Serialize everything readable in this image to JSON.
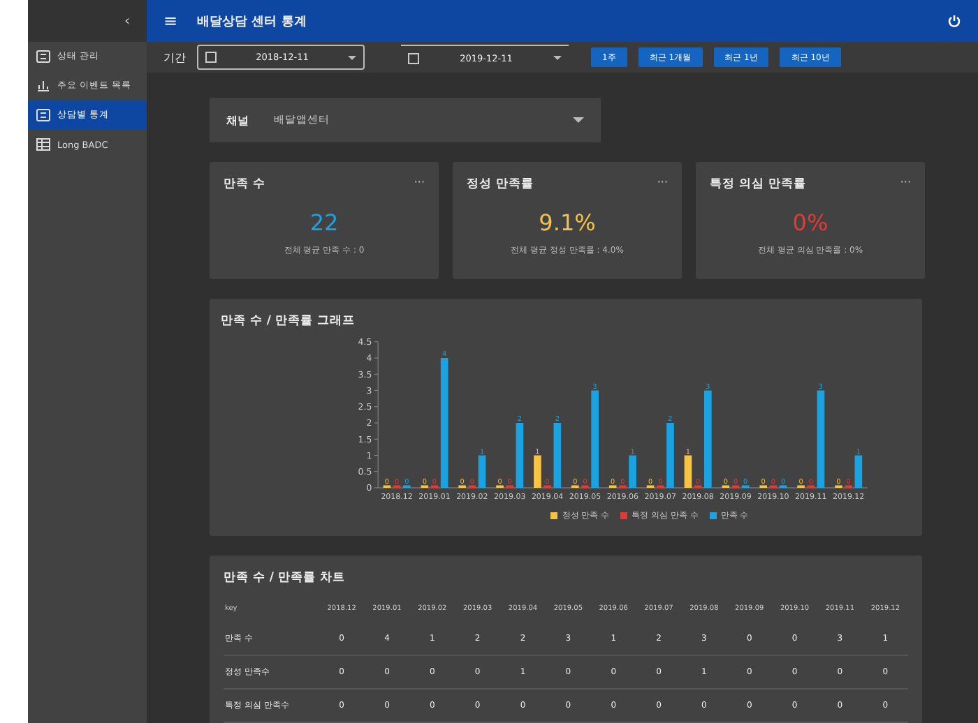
{
  "sidebar": {
    "collapse": "‹",
    "items": [
      {
        "label": "상태 관리",
        "kind": "grid",
        "selected": false
      },
      {
        "label": "주요 이벤트 목록",
        "kind": "chart",
        "selected": false
      },
      {
        "label": "상담별 통계",
        "kind": "grid",
        "selected": true
      },
      {
        "label": "Long BADC",
        "kind": "table",
        "selected": false
      }
    ]
  },
  "header": {
    "menu": "≡",
    "title": "배달상담 센터 통계"
  },
  "filter": {
    "label": "기간",
    "start": "2018-12-11",
    "end": "2019-12-11",
    "presets": [
      "1주",
      "최근 1개월",
      "최근 1년",
      "최근 10년"
    ]
  },
  "channel": {
    "label": "채널",
    "value": "배달앱센터"
  },
  "cards": [
    {
      "title": "만족 수",
      "menu": "···",
      "value": "22",
      "color": "#1aa3e0",
      "note": "전체 평균 만족 수 : 0"
    },
    {
      "title": "정성 만족률",
      "menu": "···",
      "value": "9.1%",
      "color": "#f2c14e",
      "note": "전체 평균 정성 만족률 : 4.0%"
    },
    {
      "title": "특정 의심 만족률",
      "menu": "···",
      "value": "0%",
      "color": "#e53935",
      "note": "전체 평균 의심 만족률 : 0%"
    }
  ],
  "chart_card": {
    "title": "만족 수 / 만족률 그래프",
    "chart_data": {
      "type": "bar",
      "categories": [
        "2018.12",
        "2019.01",
        "2019.02",
        "2019.03",
        "2019.04",
        "2019.05",
        "2019.06",
        "2019.07",
        "2019.08",
        "2019.09",
        "2019.10",
        "2019.11",
        "2019.12"
      ],
      "series": [
        {
          "name": "정성 만족 수",
          "color": "#f6c343",
          "values": [
            0,
            0,
            0,
            0,
            1,
            0,
            0,
            0,
            1,
            0,
            0,
            0,
            0
          ]
        },
        {
          "name": "특정 의심 만족 수",
          "color": "#e53935",
          "values": [
            0,
            0,
            0,
            0,
            0,
            0,
            0,
            0,
            0,
            0,
            0,
            0,
            0
          ]
        },
        {
          "name": "만족 수",
          "color": "#1aa3e0",
          "values": [
            0,
            4,
            1,
            2,
            2,
            3,
            1,
            2,
            3,
            0,
            0,
            3,
            1
          ]
        }
      ],
      "ylim": [
        0,
        4.5
      ],
      "yticks": [
        0,
        0.5,
        1,
        1.5,
        2,
        2.5,
        3,
        3.5,
        4,
        4.5
      ],
      "data_labels": true
    }
  },
  "table_card": {
    "title": "만족 수 / 만족률 차트",
    "columns": [
      "key",
      "2018.12",
      "2019.01",
      "2019.02",
      "2019.03",
      "2019.04",
      "2019.05",
      "2019.06",
      "2019.07",
      "2019.08",
      "2019.09",
      "2019.10",
      "2019.11",
      "2019.12"
    ],
    "rows": [
      [
        "만족 수",
        "0",
        "4",
        "1",
        "2",
        "2",
        "3",
        "1",
        "2",
        "3",
        "0",
        "0",
        "3",
        "1"
      ],
      [
        "정성 만족수",
        "0",
        "0",
        "0",
        "0",
        "1",
        "0",
        "0",
        "0",
        "1",
        "0",
        "0",
        "0",
        "0"
      ],
      [
        "특정 의심 만족수",
        "0",
        "0",
        "0",
        "0",
        "0",
        "0",
        "0",
        "0",
        "0",
        "0",
        "0",
        "0",
        "0"
      ]
    ]
  }
}
